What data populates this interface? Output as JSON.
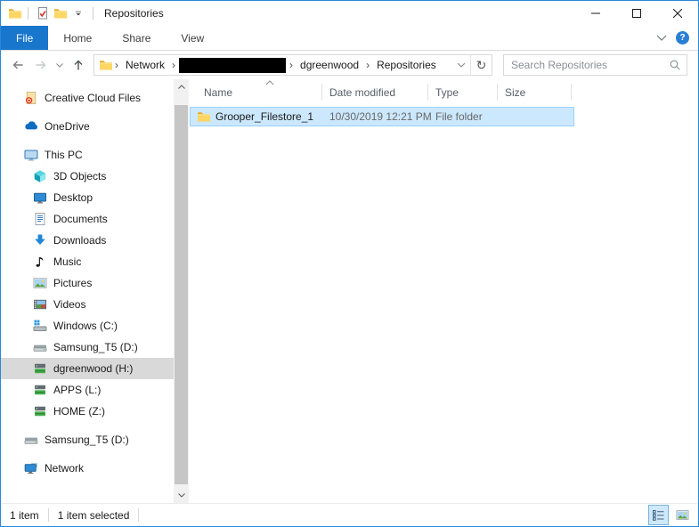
{
  "window": {
    "title": "Repositories"
  },
  "ribbon": {
    "tabs": [
      {
        "label": "File",
        "active": true
      },
      {
        "label": "Home",
        "active": false
      },
      {
        "label": "Share",
        "active": false
      },
      {
        "label": "View",
        "active": false
      }
    ],
    "help_glyph": "?"
  },
  "toolbar": {
    "refresh_glyph": "↻",
    "breadcrumb": {
      "segments": [
        {
          "label": "Network",
          "redacted": false
        },
        {
          "label": "",
          "redacted": true
        },
        {
          "label": "dgreenwood",
          "redacted": false
        },
        {
          "label": "Repositories",
          "redacted": false
        }
      ],
      "separator": "›"
    },
    "search_placeholder": "Search Repositories"
  },
  "sidebar": {
    "items": [
      {
        "label": "Creative Cloud Files",
        "icon": "creative-cloud-icon",
        "level": 0,
        "selected": false
      },
      {
        "label": "OneDrive",
        "icon": "onedrive-icon",
        "level": 0,
        "selected": false
      },
      {
        "label": "This PC",
        "icon": "this-pc-icon",
        "level": 0,
        "selected": false
      },
      {
        "label": "3D Objects",
        "icon": "3d-objects-icon",
        "level": 1,
        "selected": false
      },
      {
        "label": "Desktop",
        "icon": "desktop-icon",
        "level": 1,
        "selected": false
      },
      {
        "label": "Documents",
        "icon": "documents-icon",
        "level": 1,
        "selected": false
      },
      {
        "label": "Downloads",
        "icon": "downloads-icon",
        "level": 1,
        "selected": false
      },
      {
        "label": "Music",
        "icon": "music-icon",
        "level": 1,
        "selected": false
      },
      {
        "label": "Pictures",
        "icon": "pictures-icon",
        "level": 1,
        "selected": false
      },
      {
        "label": "Videos",
        "icon": "videos-icon",
        "level": 1,
        "selected": false
      },
      {
        "label": "Windows (C:)",
        "icon": "windows-drive-icon",
        "level": 1,
        "selected": false
      },
      {
        "label": "Samsung_T5 (D:)",
        "icon": "drive-icon",
        "level": 1,
        "selected": false
      },
      {
        "label": "dgreenwood (H:)",
        "icon": "network-drive-icon",
        "level": 1,
        "selected": true
      },
      {
        "label": "APPS (L:)",
        "icon": "network-drive-icon",
        "level": 1,
        "selected": false
      },
      {
        "label": "HOME (Z:)",
        "icon": "network-drive-icon",
        "level": 1,
        "selected": false
      },
      {
        "label": "Samsung_T5 (D:)",
        "icon": "drive-icon",
        "level": 0,
        "selected": false
      },
      {
        "label": "Network",
        "icon": "network-icon",
        "level": 0,
        "selected": false
      }
    ]
  },
  "file_list": {
    "columns": [
      {
        "label": "Name",
        "sorted": "asc"
      },
      {
        "label": "Date modified",
        "sorted": ""
      },
      {
        "label": "Type",
        "sorted": ""
      },
      {
        "label": "Size",
        "sorted": ""
      }
    ],
    "rows": [
      {
        "name": "Grooper_Filestore_1",
        "date_modified": "10/30/2019 12:21 PM",
        "type": "File folder",
        "size": "",
        "selected": true
      }
    ]
  },
  "status_bar": {
    "item_count": "1 item",
    "selection_status": "1 item selected"
  },
  "colors": {
    "active_tab_blue": "#1876cd",
    "row_selection_bg": "#cce8ff",
    "row_selection_border": "#99d1ff",
    "sidebar_selection_bg": "#d9d9d9",
    "window_border": "#2989d8",
    "help_blue": "#2a7fd4"
  }
}
